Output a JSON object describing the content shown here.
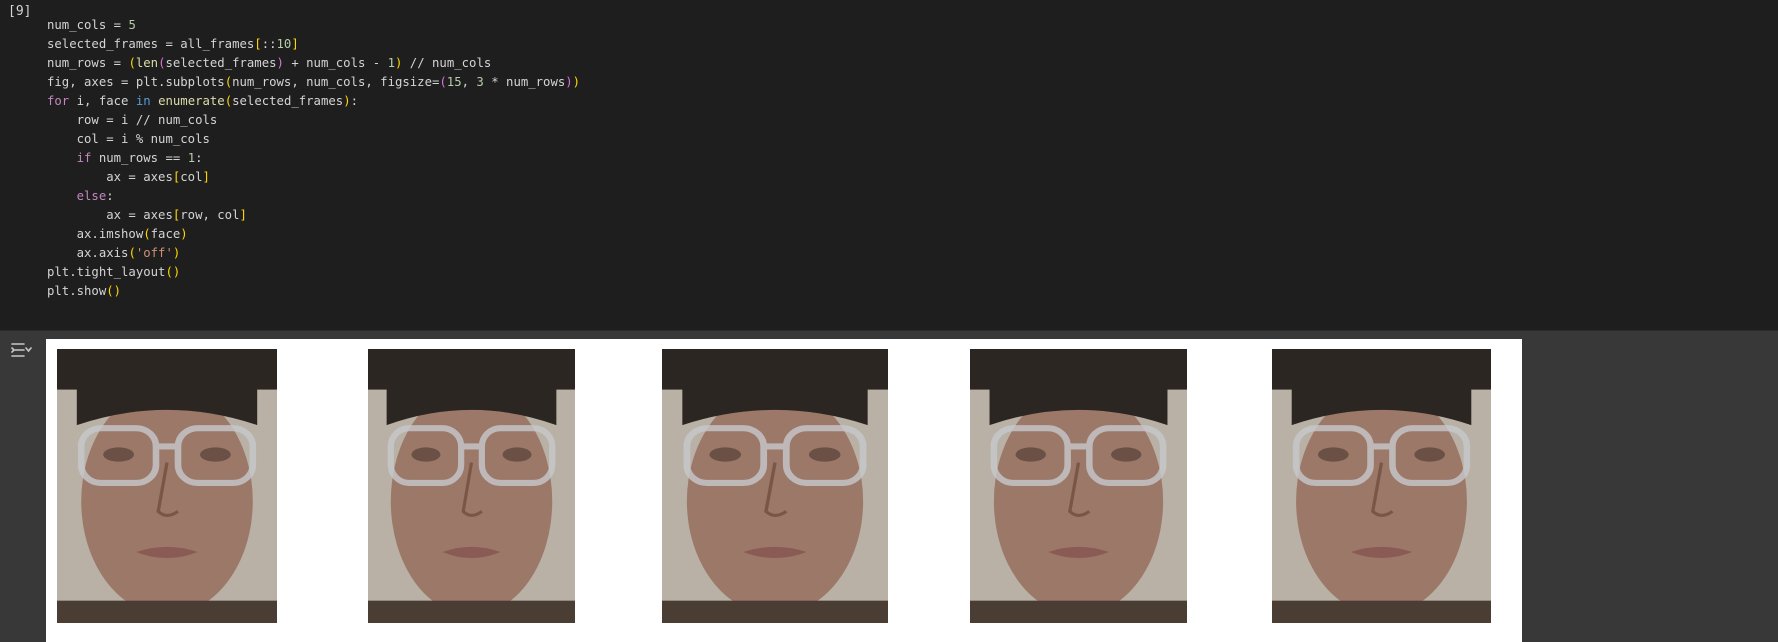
{
  "cell": {
    "execution_count": "[9]",
    "code_lines": [
      "num_cols = 5",
      "selected_frames = all_frames[::10]",
      "num_rows = (len(selected_frames) + num_cols - 1) // num_cols",
      "fig, axes = plt.subplots(num_rows, num_cols, figsize=(15, 3 * num_rows))",
      "for i, face in enumerate(selected_frames):",
      "    row = i // num_cols",
      "    col = i % num_cols",
      "    if num_rows == 1:",
      "        ax = axes[col]",
      "    else:",
      "        ax = axes[row, col]",
      "    ax.imshow(face)",
      "    ax.axis('off')",
      "plt.tight_layout()",
      "plt.show()"
    ]
  },
  "output": {
    "icon": "output-toggle-icon",
    "frame_count": 5
  },
  "colors": {
    "editor_bg": "#1e1e1e",
    "output_bg": "#383838",
    "keyword": "#c586c0",
    "function": "#dcdcaa",
    "number": "#b5cea8",
    "string": "#ce9178"
  }
}
